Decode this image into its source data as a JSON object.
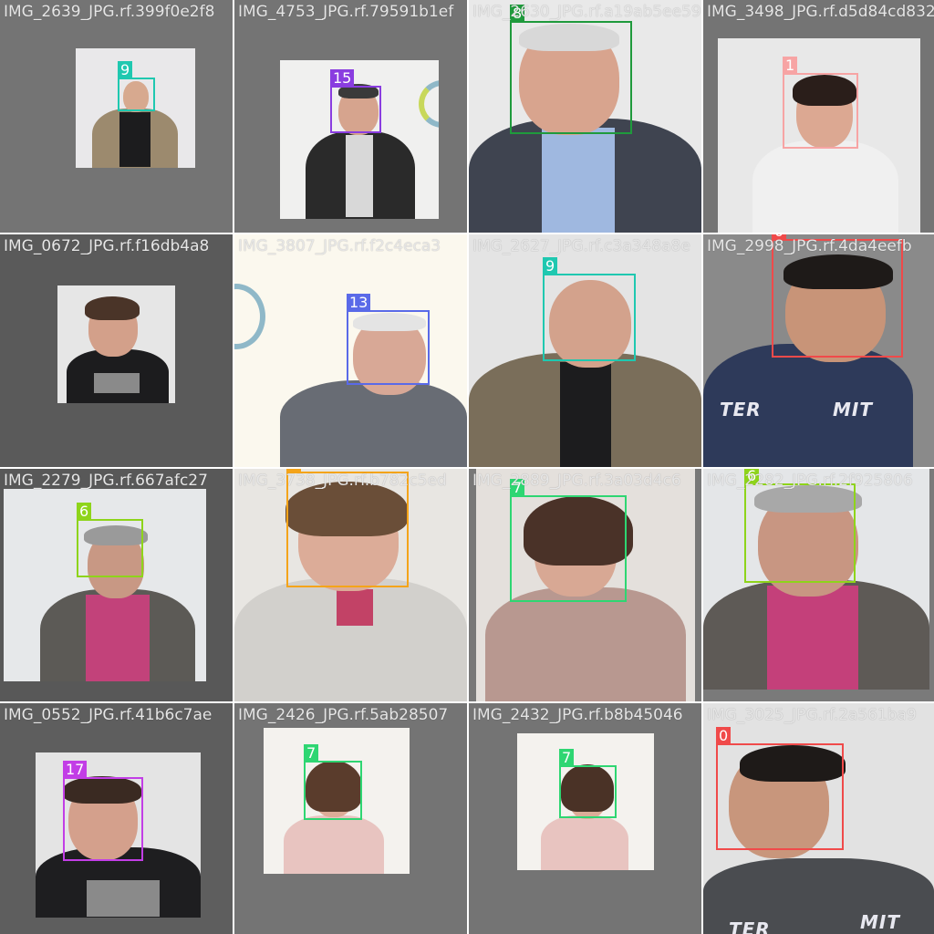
{
  "window": {
    "title": ""
  },
  "mosaic": {
    "tiles": [
      {
        "title": "IMG_2639_JPG.rf.399f0e2f8",
        "box_label": "9",
        "box_color": "#1fc8b0"
      },
      {
        "title": "IMG_4753_JPG.rf.79591b1ef",
        "box_label": "15",
        "box_color": "#8a3de0"
      },
      {
        "title": "IMG_2630_JPG.rf.a19ab5ee59d23a5",
        "box_label": "8",
        "box_color": "#1f9a3c"
      },
      {
        "title": "IMG_3498_JPG.rf.d5d84cd832",
        "box_label": "1",
        "box_color": "#f7a4a4"
      },
      {
        "title": "IMG_0672_JPG.rf.f16db4a8",
        "box_label": "17",
        "box_color": "#c23ee6"
      },
      {
        "title": "IMG_3807_JPG.rf.f2c4eca3",
        "box_label": "13",
        "box_color": "#5a6ae8"
      },
      {
        "title": "IMG_2627_JPG.rf.c3a348a8e",
        "box_label": "9",
        "box_color": "#1fc8b0"
      },
      {
        "title": "IMG_2998_JPG.rf.4da4eefb",
        "box_label": "0",
        "box_color": "#f04a4a"
      },
      {
        "title": "IMG_2279_JPG.rf.667afc27",
        "box_label": "6",
        "box_color": "#8ed41a"
      },
      {
        "title": "IMG_3738_JPG.rf.b782c5ed",
        "box_label": "3",
        "box_color": "#f4a41a"
      },
      {
        "title": "IMG_2889_JPG.rf.3a03d4c6",
        "box_label": "7",
        "box_color": "#2ed672"
      },
      {
        "title": "IMG_2282_JPG.rf.2f925806",
        "box_label": "6",
        "box_color": "#8ed41a"
      },
      {
        "title": "IMG_0552_JPG.rf.41b6c7ae",
        "box_label": "17",
        "box_color": "#c23ee6"
      },
      {
        "title": "IMG_2426_JPG.rf.5ab28507",
        "box_label": "7",
        "box_color": "#2ed672"
      },
      {
        "title": "IMG_2432_JPG.rf.b8b45046",
        "box_label": "7",
        "box_color": "#2ed672"
      },
      {
        "title": "IMG_3025_JPG.rf.2a561ba9",
        "box_label": "0",
        "box_color": "#f04a4a"
      }
    ],
    "shirt_texts": {
      "ter": "TER",
      "mit": "MIT"
    }
  }
}
